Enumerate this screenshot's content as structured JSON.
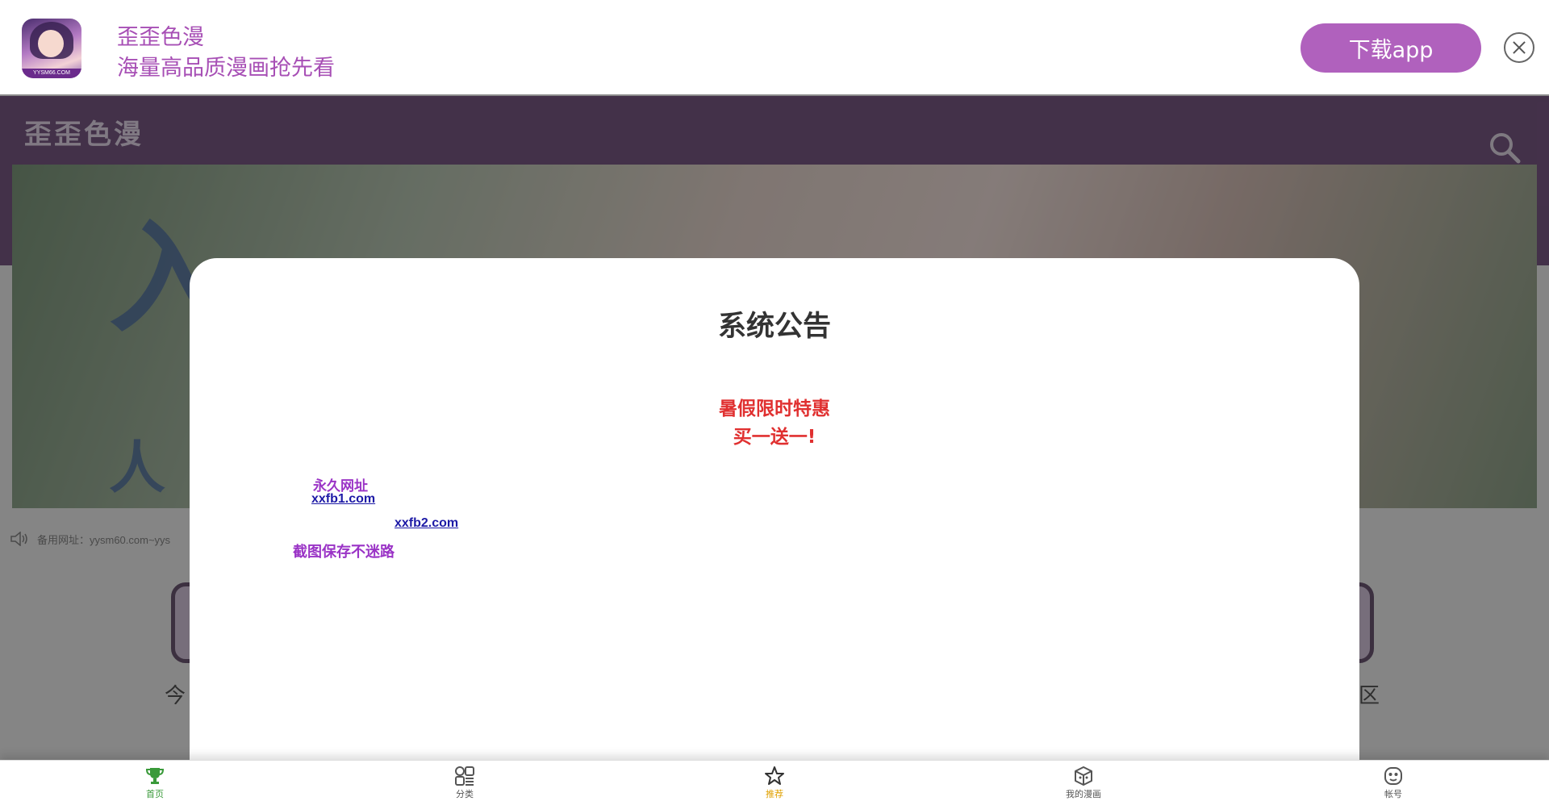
{
  "banner": {
    "app_name": "歪歪色漫",
    "slogan": "海量高品质漫画抢先看",
    "icon_caption": "YYSM66.COM",
    "download_label": "下载app"
  },
  "header": {
    "logo": "歪歪色漫"
  },
  "hero": {
    "big_text": "入",
    "sub_text": "人"
  },
  "notice": {
    "text": "备用网址：yysm60.com~yys"
  },
  "quick_links": {
    "left_label": "今",
    "right_label": "区"
  },
  "modal": {
    "title": "系统公告",
    "promo_line1": "暑假限时特惠",
    "promo_line2": "买一送一!",
    "permanent_label": "永久网址",
    "link1": "xxfb1.com",
    "link2": "xxfb2.com",
    "save_tip": "截图保存不迷路"
  },
  "tabbar": {
    "items": [
      {
        "label": "首页",
        "icon": "trophy-icon",
        "color": "#3a9a3a"
      },
      {
        "label": "分类",
        "icon": "category-icon",
        "color": "#555555"
      },
      {
        "label": "推荐",
        "icon": "star-icon",
        "color": "#e0a000"
      },
      {
        "label": "我的漫画",
        "icon": "book-box-icon",
        "color": "#555555"
      },
      {
        "label": "帐号",
        "icon": "face-icon",
        "color": "#555555"
      }
    ]
  },
  "colors": {
    "brand": "#b061bd",
    "promo": "#e03030",
    "link": "#1d1aa6",
    "accent_text": "#9a33c6"
  }
}
